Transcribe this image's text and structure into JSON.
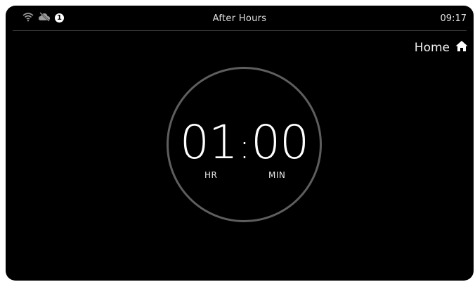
{
  "status_bar": {
    "title": "After Hours",
    "time": "09:17",
    "icons": [
      "wifi-icon",
      "cloud-off-icon",
      "notification-badge"
    ],
    "notification_count": "1"
  },
  "nav": {
    "home_label": "Home",
    "home_icon": "home-icon"
  },
  "timer": {
    "hours": "01",
    "separator": ":",
    "minutes": "00",
    "hours_label": "HR",
    "minutes_label": "MIN"
  },
  "colors": {
    "background": "#000000",
    "text": "#ffffff",
    "ring": "#5e5e5e"
  }
}
